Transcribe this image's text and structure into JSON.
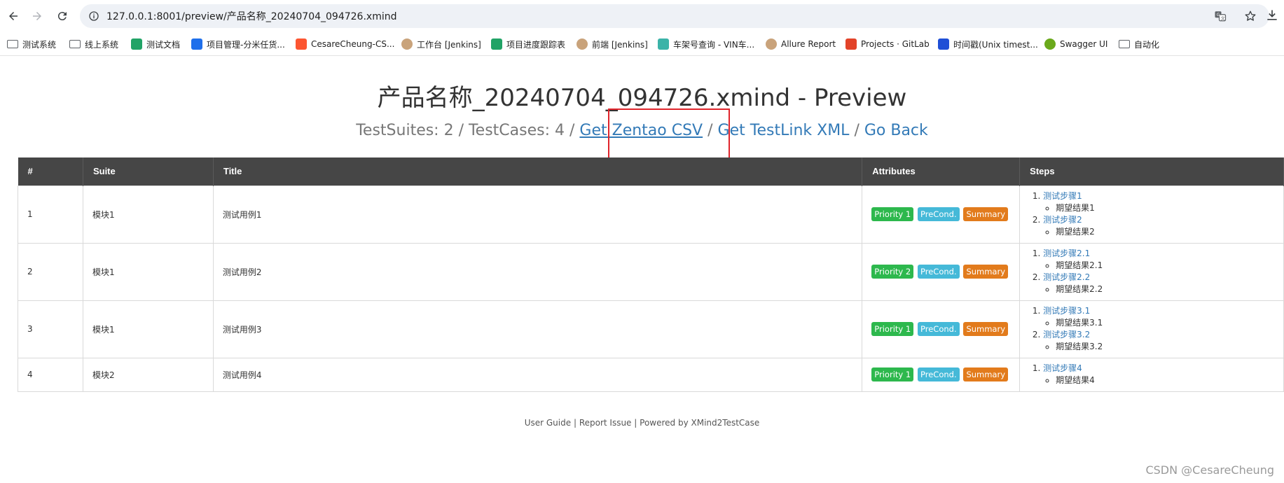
{
  "browser": {
    "url": "127.0.0.1:8001/preview/产品名称_20240704_094726.xmind",
    "bookmarks": [
      {
        "label": "测试系统",
        "icon": "folder-icon",
        "color": "#5f6368"
      },
      {
        "label": "线上系统",
        "icon": "folder-icon",
        "color": "#5f6368"
      },
      {
        "label": "测试文档",
        "icon": "sheet-icon",
        "color": "#21a366"
      },
      {
        "label": "项目管理-分米任货...",
        "icon": "task-icon",
        "color": "#1f6feb"
      },
      {
        "label": "CesareCheung-CS...",
        "icon": "csdn-icon",
        "color": "#fc5531"
      },
      {
        "label": "工作台 [Jenkins]",
        "icon": "jenkins-icon",
        "color": "#c9a37b"
      },
      {
        "label": "项目进度跟踪表",
        "icon": "sheet-icon",
        "color": "#21a366"
      },
      {
        "label": "前端 [Jenkins]",
        "icon": "jenkins-icon",
        "color": "#c9a37b"
      },
      {
        "label": "车架号查询 - VIN车...",
        "icon": "vin-icon",
        "color": "#3bb3a8"
      },
      {
        "label": "Allure Report",
        "icon": "jenkins-icon",
        "color": "#c9a37b"
      },
      {
        "label": "Projects · GitLab",
        "icon": "gitlab-icon",
        "color": "#e24329"
      },
      {
        "label": "时间戳(Unix timest...",
        "icon": "unix-icon",
        "color": "#1f4fd6"
      },
      {
        "label": "Swagger UI",
        "icon": "swagger-icon",
        "color": "#6aa91b"
      },
      {
        "label": "自动化",
        "icon": "folder-icon",
        "color": "#5f6368"
      }
    ]
  },
  "page": {
    "title": "产品名称_20240704_094726.xmind - Preview",
    "stats": "TestSuites: 2 / TestCases: 4 /",
    "link_zentao": "Get Zentao CSV",
    "sep1": "/",
    "link_testlink": "Get TestLink XML",
    "sep2": "/",
    "link_back": "Go Back"
  },
  "table": {
    "headers": [
      "#",
      "Suite",
      "Title",
      "Attributes",
      "Steps"
    ],
    "rows": [
      {
        "num": "1",
        "suite": "模块1",
        "title": "测试用例1",
        "priority": "Priority 1",
        "precond": "PreCond.",
        "summary": "Summary",
        "steps": [
          {
            "step": "测试步骤1",
            "result": "期望结果1"
          },
          {
            "step": "测试步骤2",
            "result": "期望结果2"
          }
        ]
      },
      {
        "num": "2",
        "suite": "模块1",
        "title": "测试用例2",
        "priority": "Priority 2",
        "precond": "PreCond.",
        "summary": "Summary",
        "steps": [
          {
            "step": "测试步骤2.1",
            "result": "期望结果2.1"
          },
          {
            "step": "测试步骤2.2",
            "result": "期望结果2.2"
          }
        ]
      },
      {
        "num": "3",
        "suite": "模块1",
        "title": "测试用例3",
        "priority": "Priority 1",
        "precond": "PreCond.",
        "summary": "Summary",
        "steps": [
          {
            "step": "测试步骤3.1",
            "result": "期望结果3.1"
          },
          {
            "step": "测试步骤3.2",
            "result": "期望结果3.2"
          }
        ]
      },
      {
        "num": "4",
        "suite": "模块2",
        "title": "测试用例4",
        "priority": "Priority 1",
        "precond": "PreCond.",
        "summary": "Summary",
        "steps": [
          {
            "step": "测试步骤4",
            "result": "期望结果4"
          }
        ]
      }
    ]
  },
  "footer": {
    "user_guide": "User Guide",
    "report_issue": "Report Issue",
    "powered_by": "Powered by XMind2TestCase",
    "sep": "|"
  },
  "watermark": "CSDN @CesareCheung",
  "colors": {
    "header_bg": "#464646",
    "link": "#337ab7",
    "badge_green": "#2db84d",
    "badge_blue": "#45b9d8",
    "badge_orange": "#e27b1c",
    "highlight": "#e0242b"
  }
}
